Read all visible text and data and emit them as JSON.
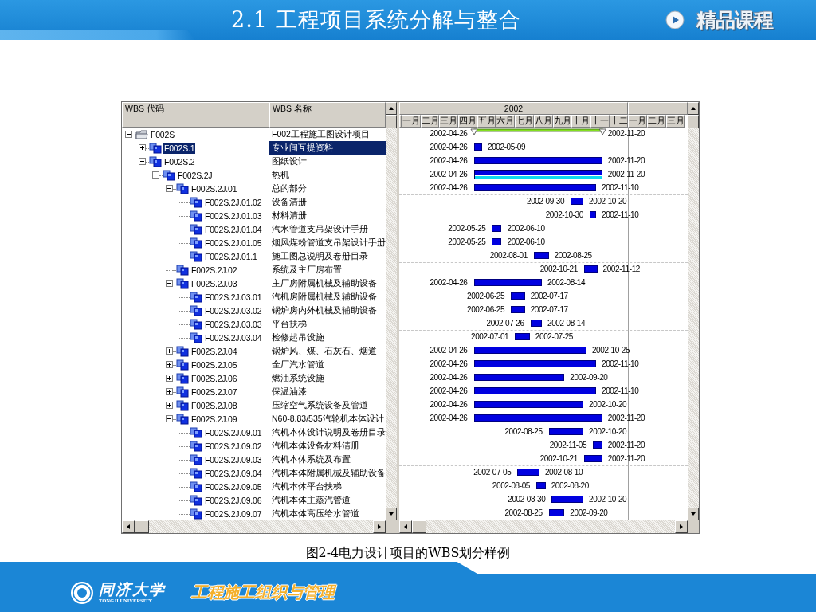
{
  "slide": {
    "title": "2.1 工程项目系统分解与整合",
    "badge": "精品课程"
  },
  "window": {
    "tree": {
      "columns": [
        "WBS 代码",
        "WBS 名称"
      ],
      "nodes": [
        {
          "code": "F002S",
          "name": "F002工程施工图设计项目",
          "kind": "project",
          "expanded": true,
          "selected": false,
          "children": [
            {
              "code": "F002S.1",
              "name": "专业间互提资料",
              "kind": "element",
              "expanded": false,
              "selected": true
            },
            {
              "code": "F002S.2",
              "name": "图纸设计",
              "kind": "element",
              "expanded": true,
              "selected": false,
              "children": [
                {
                  "code": "F002S.2J",
                  "name": "热机",
                  "kind": "element",
                  "expanded": true,
                  "selected": false,
                  "children": [
                    {
                      "code": "F002S.2J.01",
                      "name": "总的部分",
                      "kind": "element",
                      "expanded": true,
                      "selected": false,
                      "children": [
                        {
                          "code": "F002S.2J.01.02",
                          "name": "设备清册",
                          "kind": "element",
                          "selected": false
                        },
                        {
                          "code": "F002S.2J.01.03",
                          "name": "材料清册",
                          "kind": "element",
                          "selected": false
                        },
                        {
                          "code": "F002S.2J.01.04",
                          "name": "汽水管道支吊架设计手册",
                          "kind": "element",
                          "selected": false
                        },
                        {
                          "code": "F002S.2J.01.05",
                          "name": "烟风煤粉管道支吊架设计手册",
                          "kind": "element",
                          "selected": false
                        },
                        {
                          "code": "F002S.2J.01.1",
                          "name": "施工图总说明及卷册目录",
                          "kind": "element",
                          "selected": false
                        }
                      ]
                    },
                    {
                      "code": "F002S.2J.02",
                      "name": "系统及主厂房布置",
                      "kind": "element",
                      "selected": false
                    },
                    {
                      "code": "F002S.2J.03",
                      "name": "主厂房附属机械及辅助设备",
                      "kind": "element",
                      "expanded": true,
                      "selected": false,
                      "children": [
                        {
                          "code": "F002S.2J.03.01",
                          "name": "汽机房附属机械及辅助设备",
                          "kind": "element",
                          "selected": false
                        },
                        {
                          "code": "F002S.2J.03.02",
                          "name": "锅炉房内外机械及辅助设备",
                          "kind": "element",
                          "selected": false
                        },
                        {
                          "code": "F002S.2J.03.03",
                          "name": "平台扶梯",
                          "kind": "element",
                          "selected": false
                        },
                        {
                          "code": "F002S.2J.03.04",
                          "name": "检修起吊设施",
                          "kind": "element",
                          "selected": false
                        }
                      ]
                    },
                    {
                      "code": "F002S.2J.04",
                      "name": "锅炉风、煤、石灰石、烟道",
                      "kind": "element",
                      "expanded": false,
                      "selected": false
                    },
                    {
                      "code": "F002S.2J.05",
                      "name": "全厂汽水管道",
                      "kind": "element",
                      "expanded": false,
                      "selected": false
                    },
                    {
                      "code": "F002S.2J.06",
                      "name": "燃油系统设施",
                      "kind": "element",
                      "expanded": false,
                      "selected": false
                    },
                    {
                      "code": "F002S.2J.07",
                      "name": "保温油漆",
                      "kind": "element",
                      "expanded": false,
                      "selected": false
                    },
                    {
                      "code": "F002S.2J.08",
                      "name": "压缩空气系统设备及管道",
                      "kind": "element",
                      "expanded": false,
                      "selected": false
                    },
                    {
                      "code": "F002S.2J.09",
                      "name": "N60-8.83/535汽轮机本体设计",
                      "kind": "element",
                      "expanded": true,
                      "selected": false,
                      "children": [
                        {
                          "code": "F002S.2J.09.01",
                          "name": "汽机本体设计说明及卷册目录",
                          "kind": "element",
                          "selected": false
                        },
                        {
                          "code": "F002S.2J.09.02",
                          "name": "汽机本体设备材料清册",
                          "kind": "element",
                          "selected": false
                        },
                        {
                          "code": "F002S.2J.09.03",
                          "name": "汽机本体系统及布置",
                          "kind": "element",
                          "selected": false
                        },
                        {
                          "code": "F002S.2J.09.04",
                          "name": "汽机本体附属机械及辅助设备",
                          "kind": "element",
                          "selected": false
                        },
                        {
                          "code": "F002S.2J.09.05",
                          "name": "汽机本体平台扶梯",
                          "kind": "element",
                          "selected": false
                        },
                        {
                          "code": "F002S.2J.09.06",
                          "name": "汽机本体主蒸汽管道",
                          "kind": "element",
                          "selected": false
                        },
                        {
                          "code": "F002S.2J.09.07",
                          "name": "汽机本体高压给水管道",
                          "kind": "element",
                          "selected": false
                        }
                      ]
                    }
                  ]
                }
              ]
            }
          ]
        }
      ]
    },
    "gantt": {
      "year": "2002",
      "months": [
        "一月",
        "二月",
        "三月",
        "四月",
        "五月",
        "六月",
        "七月",
        "八月",
        "九月",
        "十月",
        "十一",
        "十二",
        "一月",
        "二月",
        "三月"
      ],
      "rows": [
        {
          "start": "2002-04-26",
          "end": "2002-11-20",
          "kind": "summary"
        },
        {
          "start": "2002-04-26",
          "end": "2002-05-09",
          "kind": "task"
        },
        {
          "start": "2002-04-26",
          "end": "2002-11-20",
          "kind": "task"
        },
        {
          "start": "2002-04-26",
          "end": "2002-11-20",
          "kind": "baseline"
        },
        {
          "start": "2002-04-26",
          "end": "2002-11-10",
          "kind": "task"
        },
        {
          "start": "2002-09-30",
          "end": "2002-10-20",
          "kind": "task"
        },
        {
          "start": "2002-10-30",
          "end": "2002-11-10",
          "kind": "task"
        },
        {
          "start": "2002-05-25",
          "end": "2002-06-10",
          "kind": "task"
        },
        {
          "start": "2002-05-25",
          "end": "2002-06-10",
          "kind": "task"
        },
        {
          "start": "2002-08-01",
          "end": "2002-08-25",
          "kind": "task"
        },
        {
          "start": "2002-10-21",
          "end": "2002-11-12",
          "kind": "task"
        },
        {
          "start": "2002-04-26",
          "end": "2002-08-14",
          "kind": "task"
        },
        {
          "start": "2002-06-25",
          "end": "2002-07-17",
          "kind": "task"
        },
        {
          "start": "2002-06-25",
          "end": "2002-07-17",
          "kind": "task"
        },
        {
          "start": "2002-07-26",
          "end": "2002-08-14",
          "kind": "task"
        },
        {
          "start": "2002-07-01",
          "end": "2002-07-25",
          "kind": "task"
        },
        {
          "start": "2002-04-26",
          "end": "2002-10-25",
          "kind": "task"
        },
        {
          "start": "2002-04-26",
          "end": "2002-11-10",
          "kind": "task"
        },
        {
          "start": "2002-04-26",
          "end": "2002-09-20",
          "kind": "task"
        },
        {
          "start": "2002-04-26",
          "end": "2002-11-10",
          "kind": "task"
        },
        {
          "start": "2002-04-26",
          "end": "2002-10-20",
          "kind": "task"
        },
        {
          "start": "2002-04-26",
          "end": "2002-11-20",
          "kind": "task"
        },
        {
          "start": "2002-08-25",
          "end": "2002-10-20",
          "kind": "task"
        },
        {
          "start": "2002-11-05",
          "end": "2002-11-20",
          "kind": "task"
        },
        {
          "start": "2002-10-21",
          "end": "2002-11-20",
          "kind": "task"
        },
        {
          "start": "2002-07-05",
          "end": "2002-08-10",
          "kind": "task"
        },
        {
          "start": "2002-08-05",
          "end": "2002-08-20",
          "kind": "task"
        },
        {
          "start": "2002-08-30",
          "end": "2002-10-20",
          "kind": "task"
        },
        {
          "start": "2002-08-25",
          "end": "2002-09-20",
          "kind": "task"
        }
      ]
    }
  },
  "caption": "图2-4电力设计项目的WBS划分样例",
  "footer": {
    "university": "同济大学",
    "university_en": "TONGJI UNIVERSITY",
    "course": "工程施工组织与管理"
  }
}
